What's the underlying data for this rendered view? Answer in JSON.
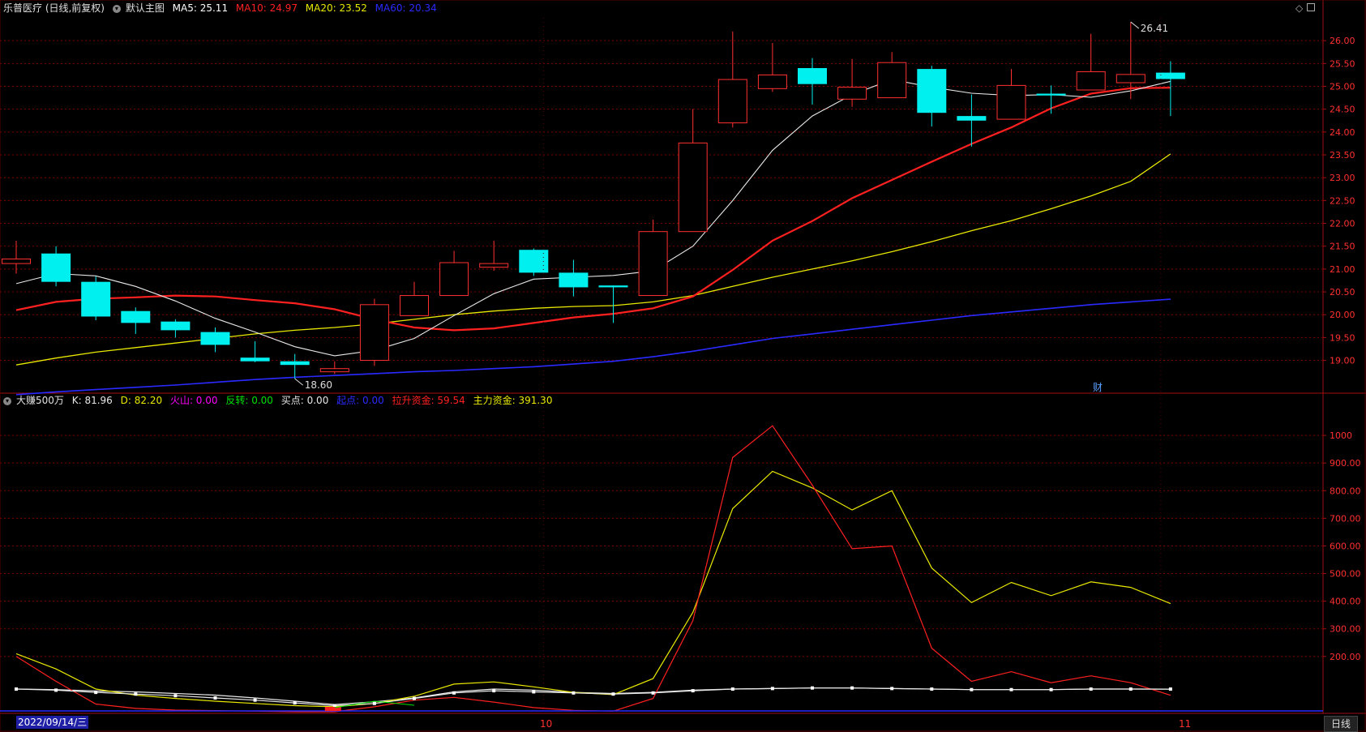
{
  "header": {
    "stock_title": "乐普医疗 (日线,前复权)",
    "main_chart_label": "默认主图",
    "ma5": {
      "label": "MA5: 25.11",
      "color": "#ffffff"
    },
    "ma10": {
      "label": "MA10: 24.97",
      "color": "#ff2020"
    },
    "ma20": {
      "label": "MA20: 23.52",
      "color": "#e8e800"
    },
    "ma60": {
      "label": "MA60: 20.34",
      "color": "#2a2aff"
    }
  },
  "indicator_header": {
    "name": "大赚500万",
    "k": {
      "label": "K: 81.96",
      "color": "#e8e8e8"
    },
    "d": {
      "label": "D: 82.20",
      "color": "#e8e800"
    },
    "huoshan": {
      "label": "火山: 0.00",
      "color": "#ff00ff"
    },
    "fanzhuan": {
      "label": "反转: 0.00",
      "color": "#00e000"
    },
    "maidian": {
      "label": "买点: 0.00",
      "color": "#e8e8e8"
    },
    "qidian": {
      "label": "起点: 0.00",
      "color": "#2a2aff"
    },
    "lasheng": {
      "label": "拉升资金: 59.54",
      "color": "#ff2020"
    },
    "zhuli": {
      "label": "主力资金: 391.30",
      "color": "#e8e800"
    }
  },
  "annotations": {
    "high_label": "26.41",
    "low_label": "18.60",
    "fin_marker": "财"
  },
  "footer": {
    "date": "2022/09/14/三",
    "month_10": "10",
    "month_11": "11",
    "period": "日线"
  },
  "chart_data": [
    {
      "type": "candlestick",
      "title": "乐普医疗 (日线,前复权)",
      "ylim": [
        18.3,
        26.5
      ],
      "y_ticks": [
        "19.00",
        "19.50",
        "20.00",
        "20.50",
        "21.00",
        "21.50",
        "22.00",
        "22.50",
        "23.00",
        "23.50",
        "24.00",
        "24.50",
        "25.00",
        "25.50",
        "26.00"
      ],
      "candles": [
        {
          "o": 21.12,
          "h": 21.62,
          "l": 20.9,
          "c": 21.22
        },
        {
          "o": 21.34,
          "h": 21.5,
          "l": 20.62,
          "c": 20.72
        },
        {
          "o": 20.72,
          "h": 20.84,
          "l": 19.88,
          "c": 19.96
        },
        {
          "o": 20.08,
          "h": 20.16,
          "l": 19.58,
          "c": 19.82
        },
        {
          "o": 19.85,
          "h": 19.9,
          "l": 19.5,
          "c": 19.66
        },
        {
          "o": 19.62,
          "h": 19.72,
          "l": 19.18,
          "c": 19.34
        },
        {
          "o": 19.06,
          "h": 19.42,
          "l": 18.96,
          "c": 18.98
        },
        {
          "o": 18.98,
          "h": 19.14,
          "l": 18.6,
          "c": 18.9
        },
        {
          "o": 18.75,
          "h": 18.98,
          "l": 18.7,
          "c": 18.82
        },
        {
          "o": 19.0,
          "h": 20.35,
          "l": 18.88,
          "c": 20.22
        },
        {
          "o": 19.98,
          "h": 20.72,
          "l": 19.98,
          "c": 20.42
        },
        {
          "o": 20.42,
          "h": 21.4,
          "l": 20.42,
          "c": 21.14
        },
        {
          "o": 21.04,
          "h": 21.62,
          "l": 20.96,
          "c": 21.12
        },
        {
          "o": 21.42,
          "h": 21.45,
          "l": 20.85,
          "c": 20.92
        },
        {
          "o": 20.92,
          "h": 21.2,
          "l": 20.4,
          "c": 20.6
        },
        {
          "o": 20.64,
          "h": 20.64,
          "l": 19.82,
          "c": 20.6
        },
        {
          "o": 20.42,
          "h": 22.08,
          "l": 20.42,
          "c": 21.82
        },
        {
          "o": 21.82,
          "h": 24.5,
          "l": 21.82,
          "c": 23.76
        },
        {
          "o": 24.2,
          "h": 26.2,
          "l": 24.1,
          "c": 25.15
        },
        {
          "o": 24.95,
          "h": 25.95,
          "l": 24.88,
          "c": 25.25
        },
        {
          "o": 25.4,
          "h": 25.62,
          "l": 24.6,
          "c": 25.05
        },
        {
          "o": 24.72,
          "h": 25.6,
          "l": 24.55,
          "c": 24.98
        },
        {
          "o": 24.75,
          "h": 25.75,
          "l": 24.75,
          "c": 25.52
        },
        {
          "o": 25.38,
          "h": 25.45,
          "l": 24.12,
          "c": 24.42
        },
        {
          "o": 24.35,
          "h": 24.82,
          "l": 23.68,
          "c": 24.25
        },
        {
          "o": 24.28,
          "h": 25.38,
          "l": 24.28,
          "c": 25.02
        },
        {
          "o": 24.84,
          "h": 25.02,
          "l": 24.4,
          "c": 24.8
        },
        {
          "o": 24.92,
          "h": 26.15,
          "l": 24.92,
          "c": 25.32
        },
        {
          "o": 25.08,
          "h": 26.41,
          "l": 24.72,
          "c": 25.26
        },
        {
          "o": 25.3,
          "h": 25.55,
          "l": 24.35,
          "c": 25.16
        }
      ],
      "ma5": [
        20.68,
        20.9,
        20.85,
        20.62,
        20.3,
        19.92,
        19.62,
        19.3,
        19.1,
        19.22,
        19.48,
        19.98,
        20.46,
        20.78,
        20.82,
        20.86,
        20.96,
        21.5,
        22.5,
        23.6,
        24.35,
        24.82,
        25.15,
        24.98,
        24.85,
        24.8,
        24.82,
        24.76,
        24.9,
        25.11
      ],
      "ma10": [
        20.1,
        20.28,
        20.35,
        20.38,
        20.42,
        20.4,
        20.32,
        20.25,
        20.12,
        19.9,
        19.72,
        19.66,
        19.7,
        19.82,
        19.94,
        20.02,
        20.14,
        20.4,
        20.98,
        21.62,
        22.05,
        22.55,
        22.95,
        23.35,
        23.74,
        24.1,
        24.52,
        24.84,
        24.96,
        24.97
      ],
      "ma20": [
        18.9,
        19.05,
        19.18,
        19.28,
        19.38,
        19.48,
        19.58,
        19.66,
        19.72,
        19.8,
        19.9,
        20.0,
        20.08,
        20.14,
        20.18,
        20.2,
        20.28,
        20.42,
        20.62,
        20.82,
        21.0,
        21.18,
        21.38,
        21.6,
        21.84,
        22.06,
        22.32,
        22.6,
        22.92,
        23.52
      ],
      "ma60": [
        18.25,
        18.31,
        18.36,
        18.41,
        18.46,
        18.52,
        18.58,
        18.63,
        18.67,
        18.71,
        18.75,
        18.78,
        18.82,
        18.86,
        18.92,
        18.98,
        19.08,
        19.2,
        19.34,
        19.48,
        19.58,
        19.68,
        19.78,
        19.88,
        19.98,
        20.06,
        20.14,
        20.22,
        20.28,
        20.34
      ]
    },
    {
      "type": "line",
      "title": "大赚500万",
      "ylim": [
        0,
        1100
      ],
      "y_ticks": [
        "200.00",
        "300.00",
        "400.00",
        "500.00",
        "600.00",
        "700.00",
        "800.00",
        "900.00",
        "1000"
      ],
      "series": [
        {
          "name": "K",
          "color": "#e8e8e8",
          "values": [
            82,
            80,
            75,
            72,
            66,
            60,
            50,
            38,
            26,
            36,
            50,
            72,
            82,
            78,
            70,
            66,
            70,
            78,
            82,
            84,
            86,
            86,
            84,
            82,
            80,
            80,
            80,
            82,
            82,
            81.96
          ]
        },
        {
          "name": "D",
          "color": "#e8e800",
          "values": [
            210,
            155,
            82,
            60,
            48,
            38,
            30,
            22,
            18,
            30,
            56,
            100,
            108,
            90,
            70,
            62,
            120,
            360,
            735,
            870,
            810,
            730,
            800,
            520,
            395,
            468,
            420,
            470,
            450,
            391.3
          ]
        },
        {
          "name": "拉升资金",
          "color": "#ff2020",
          "values": [
            200,
            110,
            28,
            12,
            6,
            4,
            2,
            0,
            0,
            18,
            42,
            52,
            35,
            15,
            5,
            2,
            48,
            330,
            920,
            1035,
            820,
            590,
            600,
            230,
            110,
            145,
            105,
            130,
            105,
            59.54
          ]
        },
        {
          "name": "买点",
          "color": "#e8e8e8",
          "values": [
            82,
            78,
            70,
            64,
            58,
            50,
            42,
            32,
            22,
            30,
            48,
            68,
            76,
            72,
            68,
            64,
            68,
            76,
            82,
            84,
            86,
            86,
            84,
            82,
            80,
            80,
            80,
            82,
            82,
            81.96
          ]
        }
      ]
    }
  ]
}
